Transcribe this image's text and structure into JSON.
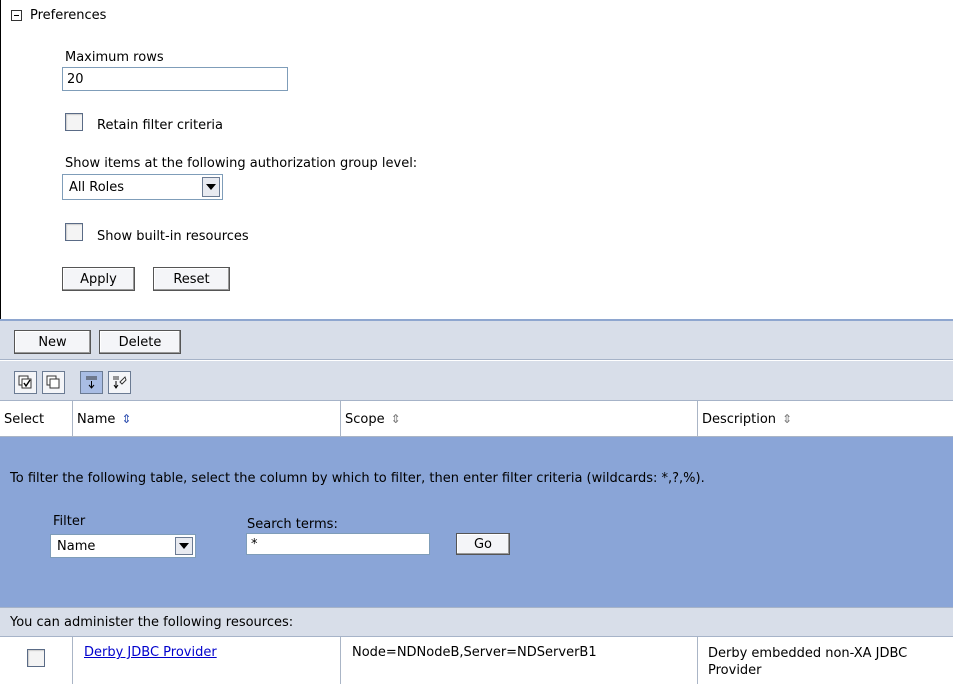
{
  "preferences": {
    "title": "Preferences",
    "max_rows_label": "Maximum rows",
    "max_rows_value": "20",
    "retain_filter_label": "Retain filter criteria",
    "auth_group_label": "Show items at the following authorization group level:",
    "auth_group_selected": "All Roles",
    "builtin_label": "Show built-in resources",
    "apply_label": "Apply",
    "reset_label": "Reset"
  },
  "toolbar": {
    "new_label": "New",
    "delete_label": "Delete",
    "icons": [
      "select-all-icon",
      "deselect-all-icon",
      "show-filter-icon",
      "clear-filter-icon"
    ]
  },
  "table": {
    "columns": [
      "Select",
      "Name",
      "Scope",
      "Description"
    ],
    "filter_instructions": "To filter the following table, select the column by which to filter, then enter filter criteria (wildcards: *,?,%).",
    "filter_label": "Filter",
    "filter_selected": "Name",
    "search_terms_label": "Search terms:",
    "search_value": "*",
    "go_label": "Go",
    "admin_text": "You can administer the following resources:",
    "rows": [
      {
        "name": "Derby JDBC Provider",
        "scope": "Node=NDNodeB,Server=NDServerB1",
        "description": "Derby embedded non-XA JDBC Provider"
      }
    ]
  },
  "colors": {
    "filter_bg": "#8aa5d7",
    "toolbar_bg": "#d8dee9",
    "link": "#0000cc"
  }
}
